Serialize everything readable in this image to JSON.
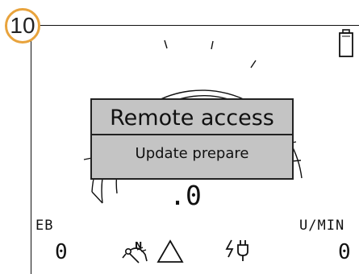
{
  "step_number": "10",
  "dialog": {
    "title": "Remote access",
    "message": "Update prepare"
  },
  "gauge": {
    "reading": ".0"
  },
  "left_readout": {
    "label": "EB",
    "value": "0"
  },
  "right_readout": {
    "label": "U/MIN",
    "value": "0"
  },
  "status_icons": [
    "neutral-engine-icon",
    "warning-triangle-icon",
    "electric-plug-icon"
  ],
  "battery_icon": "battery-icon",
  "colors": {
    "badge_border": "#e8a33c",
    "dialog_background": "#c4c4c4",
    "foreground": "#111111"
  }
}
